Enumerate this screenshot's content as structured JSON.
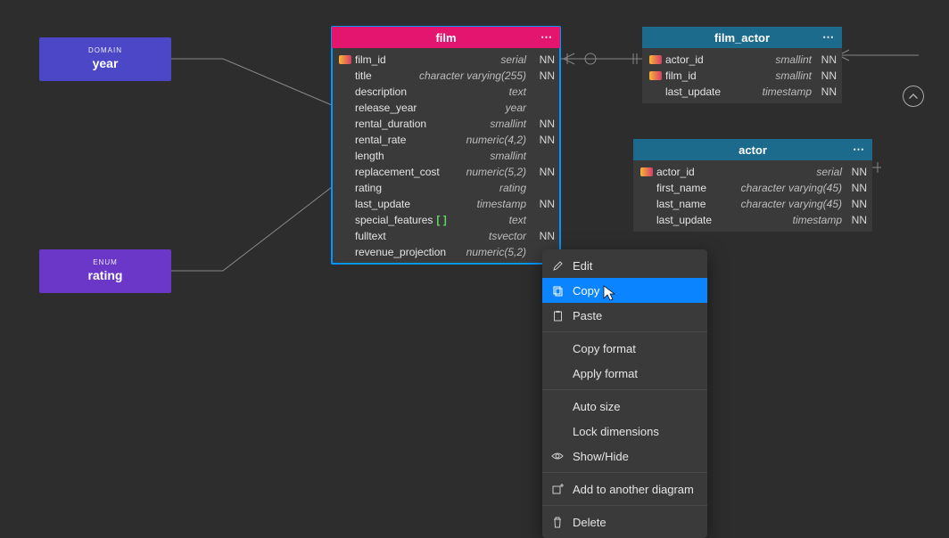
{
  "domain_box": {
    "kind": "DOMAIN",
    "name": "year"
  },
  "enum_box": {
    "kind": "ENUM",
    "name": "rating"
  },
  "tables": {
    "film": {
      "title": "film",
      "columns": [
        {
          "key": true,
          "name": "film_id",
          "type": "serial",
          "nn": "NN"
        },
        {
          "key": false,
          "name": "title",
          "type": "character varying(255)",
          "nn": "NN"
        },
        {
          "key": false,
          "name": "description",
          "type": "text",
          "nn": ""
        },
        {
          "key": false,
          "name": "release_year",
          "type": "year",
          "nn": ""
        },
        {
          "key": false,
          "name": "rental_duration",
          "type": "smallint",
          "nn": "NN"
        },
        {
          "key": false,
          "name": "rental_rate",
          "type": "numeric(4,2)",
          "nn": "NN"
        },
        {
          "key": false,
          "name": "length",
          "type": "smallint",
          "nn": ""
        },
        {
          "key": false,
          "name": "replacement_cost",
          "type": "numeric(5,2)",
          "nn": "NN"
        },
        {
          "key": false,
          "name": "rating",
          "type": "rating",
          "nn": ""
        },
        {
          "key": false,
          "name": "last_update",
          "type": "timestamp",
          "nn": "NN"
        },
        {
          "key": false,
          "name": "special_features",
          "type": "text",
          "nn": "",
          "array": "[ ]"
        },
        {
          "key": false,
          "name": "fulltext",
          "type": "tsvector",
          "nn": "NN"
        },
        {
          "key": false,
          "name": "revenue_projection",
          "type": "numeric(5,2)",
          "nn": ""
        }
      ]
    },
    "film_actor": {
      "title": "film_actor",
      "columns": [
        {
          "key": true,
          "name": "actor_id",
          "type": "smallint",
          "nn": "NN"
        },
        {
          "key": true,
          "name": "film_id",
          "type": "smallint",
          "nn": "NN"
        },
        {
          "key": false,
          "name": "last_update",
          "type": "timestamp",
          "nn": "NN"
        }
      ]
    },
    "actor": {
      "title": "actor",
      "columns": [
        {
          "key": true,
          "name": "actor_id",
          "type": "serial",
          "nn": "NN"
        },
        {
          "key": false,
          "name": "first_name",
          "type": "character varying(45)",
          "nn": "NN"
        },
        {
          "key": false,
          "name": "last_name",
          "type": "character varying(45)",
          "nn": "NN"
        },
        {
          "key": false,
          "name": "last_update",
          "type": "timestamp",
          "nn": "NN"
        }
      ]
    }
  },
  "context_menu": {
    "edit": "Edit",
    "copy": "Copy",
    "paste": "Paste",
    "copy_format": "Copy format",
    "apply_format": "Apply format",
    "auto_size": "Auto size",
    "lock_dimensions": "Lock dimensions",
    "show_hide": "Show/Hide",
    "add_to_diagram": "Add to another diagram",
    "delete": "Delete"
  }
}
